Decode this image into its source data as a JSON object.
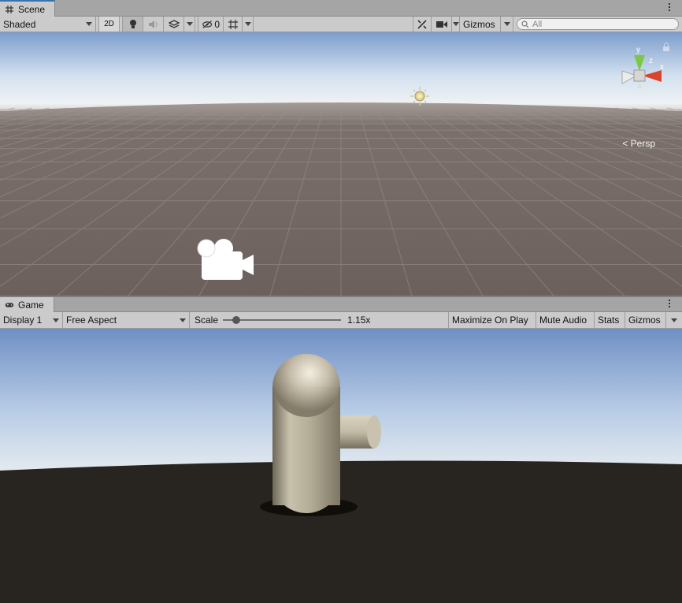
{
  "scene": {
    "tab_label": "Scene",
    "toolbar": {
      "shading_mode": "Shaded",
      "mode_2d": "2D",
      "hidden_count": "0",
      "gizmos_label": "Gizmos",
      "search_placeholder": "All"
    },
    "view": {
      "projection_label": "< Persp",
      "axis_x": "x",
      "axis_y": "y",
      "axis_z": "z"
    }
  },
  "game": {
    "tab_label": "Game",
    "toolbar": {
      "display": "Display 1",
      "aspect": "Free Aspect",
      "scale_label": "Scale",
      "scale_value": "1.15x",
      "maximize_on_play": "Maximize On Play",
      "mute_audio": "Mute Audio",
      "stats": "Stats",
      "gizmos_label": "Gizmos"
    }
  },
  "colors": {
    "accent": "#3a72b0",
    "scene_ground": "#766b68",
    "game_ground": "#28241f",
    "sky_top": "#6f8fc4",
    "capsule": "#c4bca9"
  }
}
